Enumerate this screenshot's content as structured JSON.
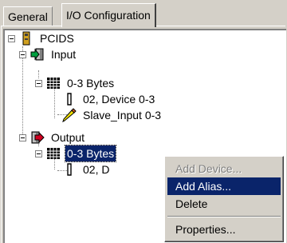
{
  "tabs": [
    {
      "label": "General"
    },
    {
      "label": "I/O Configuration"
    }
  ],
  "tree": {
    "root": "PCIDS",
    "input": "Input",
    "input_bytes": "0-3 Bytes",
    "input_device": "02, Device 0-3",
    "input_alias": "Slave_Input 0-3",
    "output": "Output",
    "output_bytes": "0-3 Bytes",
    "output_device": "02, D"
  },
  "context_menu": {
    "items": [
      {
        "label": "Add Device...",
        "disabled": true
      },
      {
        "label": "Add Alias...",
        "highlighted": true
      },
      {
        "label": "Delete"
      },
      {
        "label": "Properties..."
      }
    ]
  }
}
